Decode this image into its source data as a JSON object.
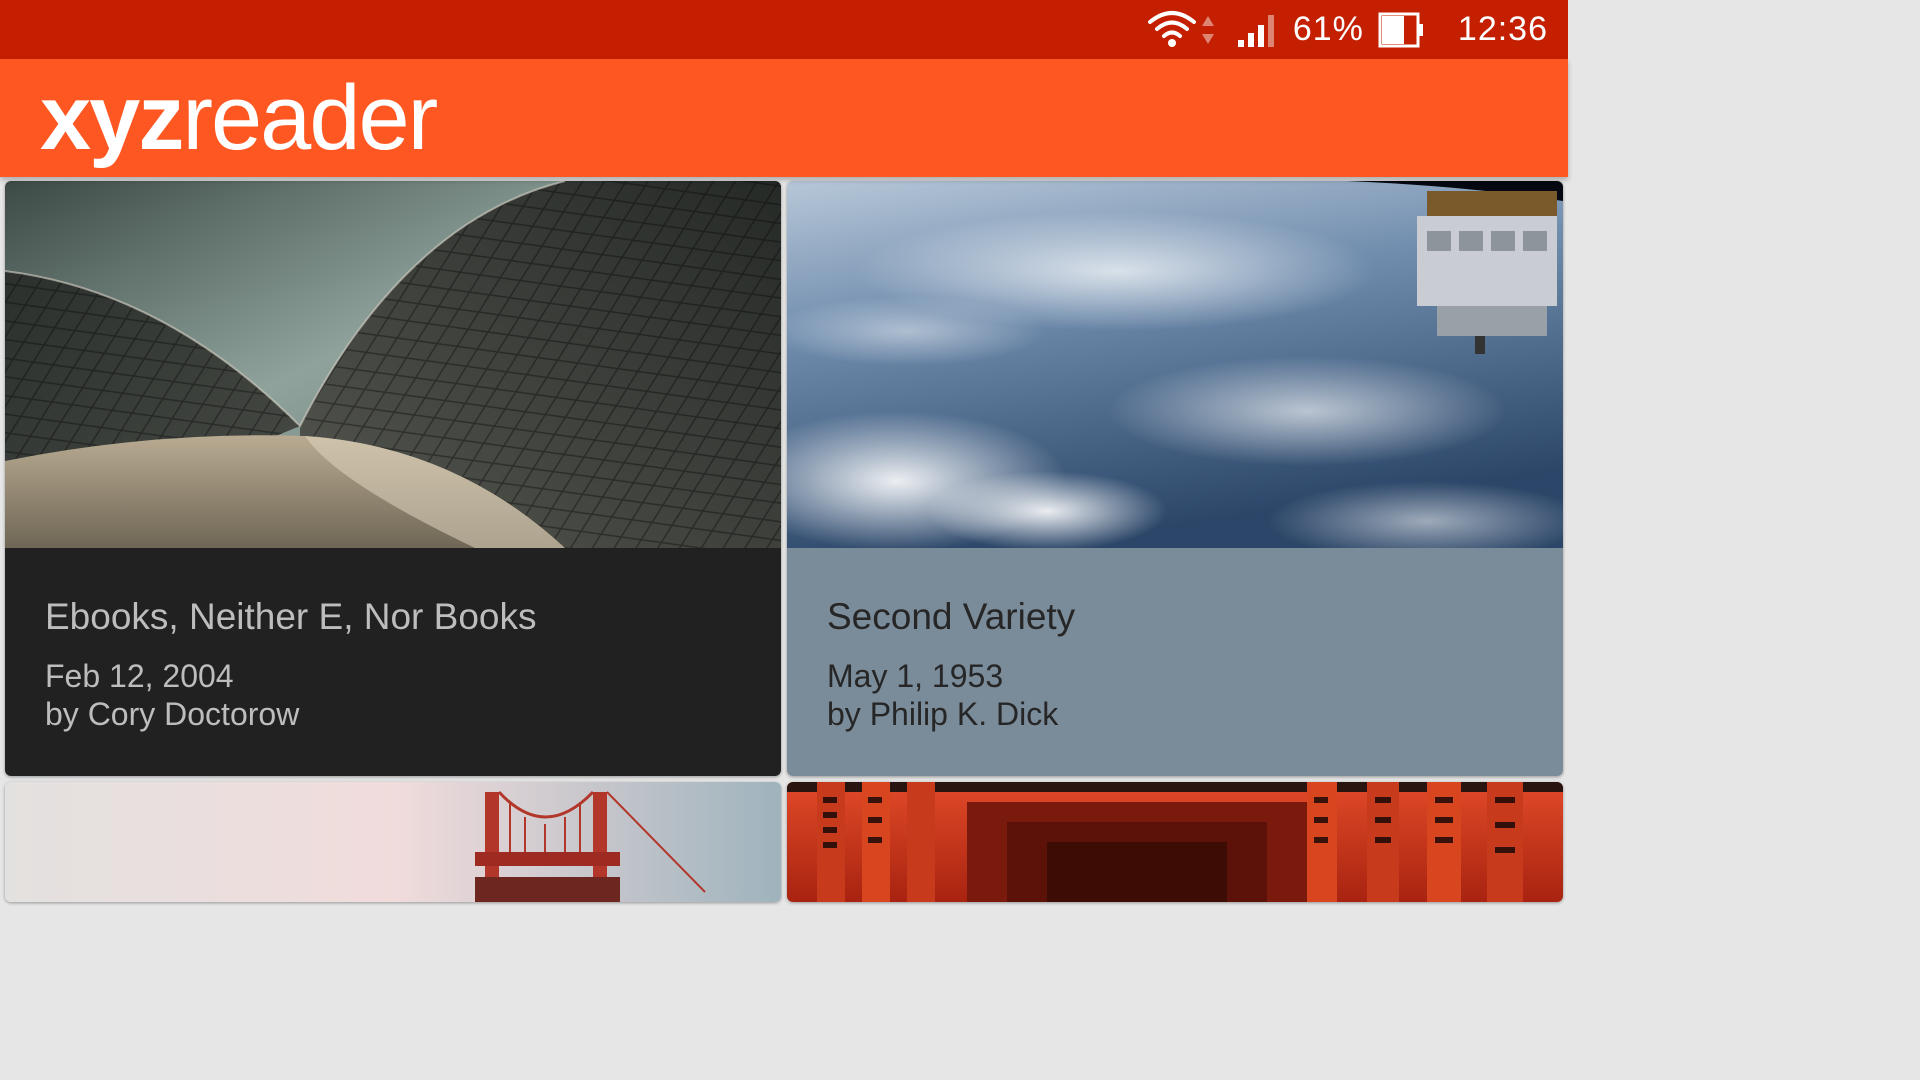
{
  "status_bar": {
    "battery_text": "61%",
    "time": "12:36",
    "icons": [
      "wifi-icon",
      "data-arrows-icon",
      "signal-icon",
      "battery-icon"
    ]
  },
  "app_bar": {
    "logo_bold": "xyz",
    "logo_light": "reader"
  },
  "colors": {
    "status_bar": "#c41f00",
    "app_bar": "#ff5722",
    "card1_meta": "#212121",
    "card2_meta": "#7a8b99"
  },
  "articles": [
    {
      "title": "Ebooks, Neither E, Nor Books",
      "date": "Feb 12, 2004",
      "author": "by Cory Doctorow",
      "image": "opera-house-roof-photo"
    },
    {
      "title": "Second Variety",
      "date": "May 1, 1953",
      "author": "by Philip K. Dick",
      "image": "earth-from-space-photo"
    },
    {
      "title": "",
      "date": "",
      "author": "",
      "image": "golden-gate-bridge-photo"
    },
    {
      "title": "",
      "date": "",
      "author": "",
      "image": "torii-gates-photo"
    }
  ]
}
